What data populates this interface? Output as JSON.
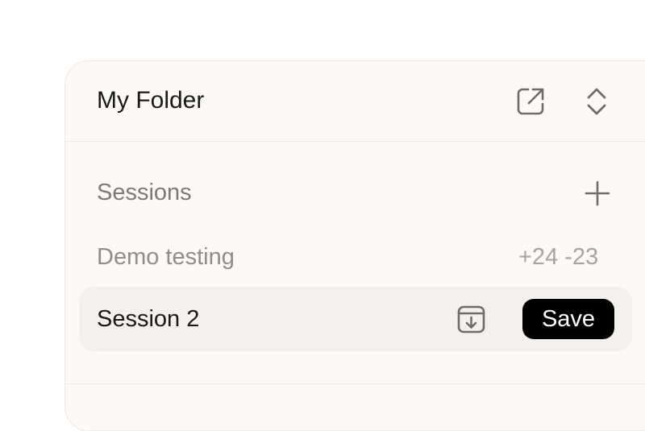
{
  "folder": {
    "title": "My Folder",
    "open_icon": "external-link-icon",
    "expand_icon": "chevrons-up-down-icon"
  },
  "sessions": {
    "label": "Sessions",
    "add_icon": "plus-icon",
    "items": [
      {
        "name": "Demo testing",
        "stats": "+24 -23",
        "active": false
      },
      {
        "name": "Session 2",
        "active": true,
        "archive_icon": "archive-download-icon",
        "save_label": "Save"
      }
    ]
  },
  "colors": {
    "panel_bg": "#fcf9f7",
    "active_row_bg": "#f3f0ee",
    "save_button_bg": "#000000"
  }
}
